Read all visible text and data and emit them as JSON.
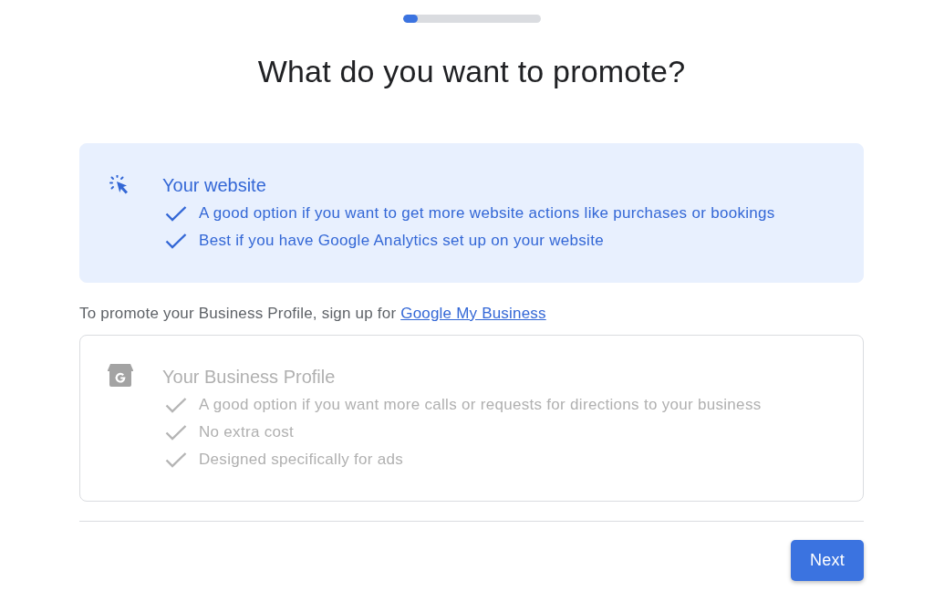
{
  "progress": {
    "level": 0.11
  },
  "heading": "What do you want to promote?",
  "options": [
    {
      "kind": "website",
      "title": "Your website",
      "selected": true,
      "disabled": false,
      "points": [
        "A good option if you want to get more website actions like purchases or bookings",
        "Best if you have Google Analytics set up on your website"
      ]
    },
    {
      "kind": "business_profile",
      "notice": {
        "text": "To promote your Business Profile, sign up for ",
        "link": "Google My Business"
      },
      "title": "Your Business Profile",
      "selected": false,
      "disabled": true,
      "points": [
        "A good option if you want more calls or requests for directions to your business",
        "No extra cost",
        "Designed specifically for ads"
      ]
    }
  ],
  "next_button": {
    "label": "Next"
  }
}
